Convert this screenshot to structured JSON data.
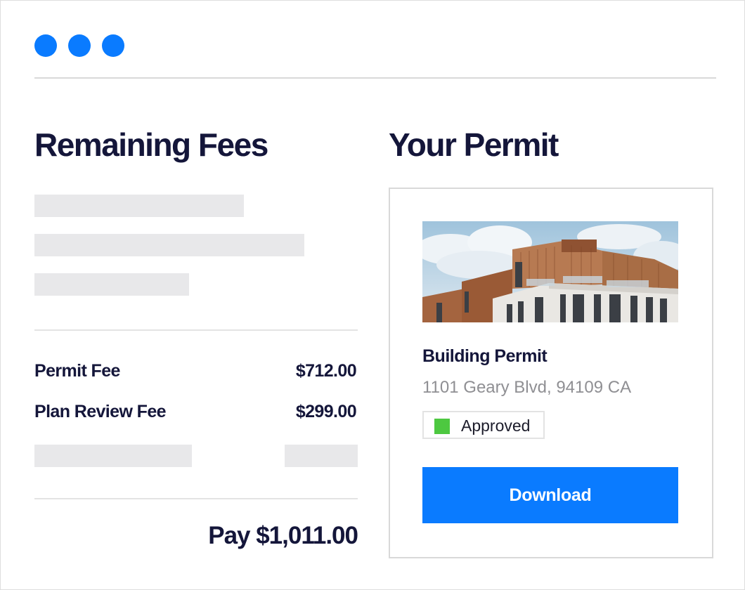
{
  "window": {
    "controls": [
      "dot-1",
      "dot-2",
      "dot-3"
    ],
    "control_color": "#0a7bff"
  },
  "fees": {
    "heading": "Remaining Fees",
    "items": [
      {
        "label": "Permit Fee",
        "amount": "$712.00"
      },
      {
        "label": "Plan Review Fee",
        "amount": "$299.00"
      }
    ],
    "pay_label": "Pay $1,011.00"
  },
  "permit": {
    "heading": "Your Permit",
    "image_icon": "building-photo",
    "title": "Building Permit",
    "address": "1101 Geary Blvd, 94109 CA",
    "status": {
      "label": "Approved",
      "color": "#4dc840"
    },
    "download_label": "Download",
    "accent_color": "#0a7bff"
  }
}
